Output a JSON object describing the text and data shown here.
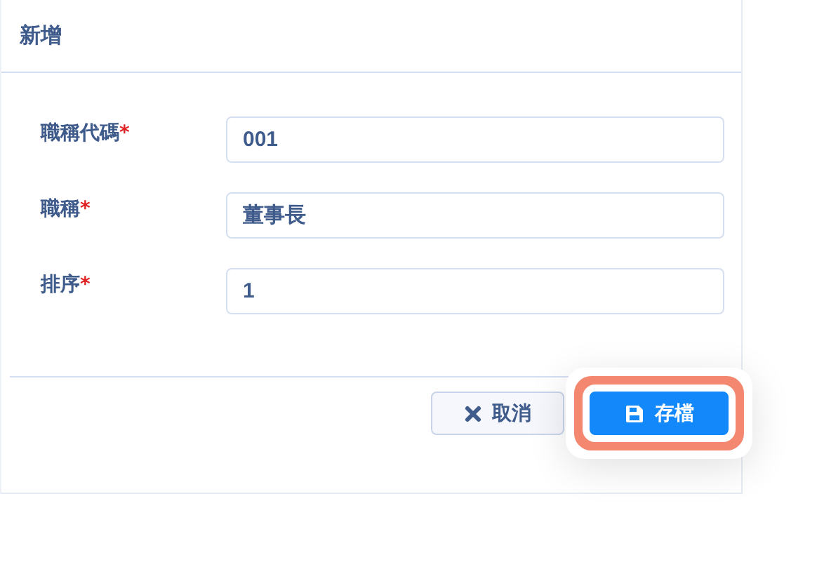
{
  "dialog": {
    "title": "新增"
  },
  "fields": [
    {
      "label": "職稱代碼",
      "required_mark": "*",
      "value": "001"
    },
    {
      "label": "職稱",
      "required_mark": "*",
      "value": "董事長"
    },
    {
      "label": "排序",
      "required_mark": "*",
      "value": "1"
    }
  ],
  "buttons": [
    {
      "kind": "cancel",
      "label": "取消",
      "highlighted": false
    },
    {
      "kind": "save",
      "label": "存檔",
      "highlighted": true
    }
  ]
}
